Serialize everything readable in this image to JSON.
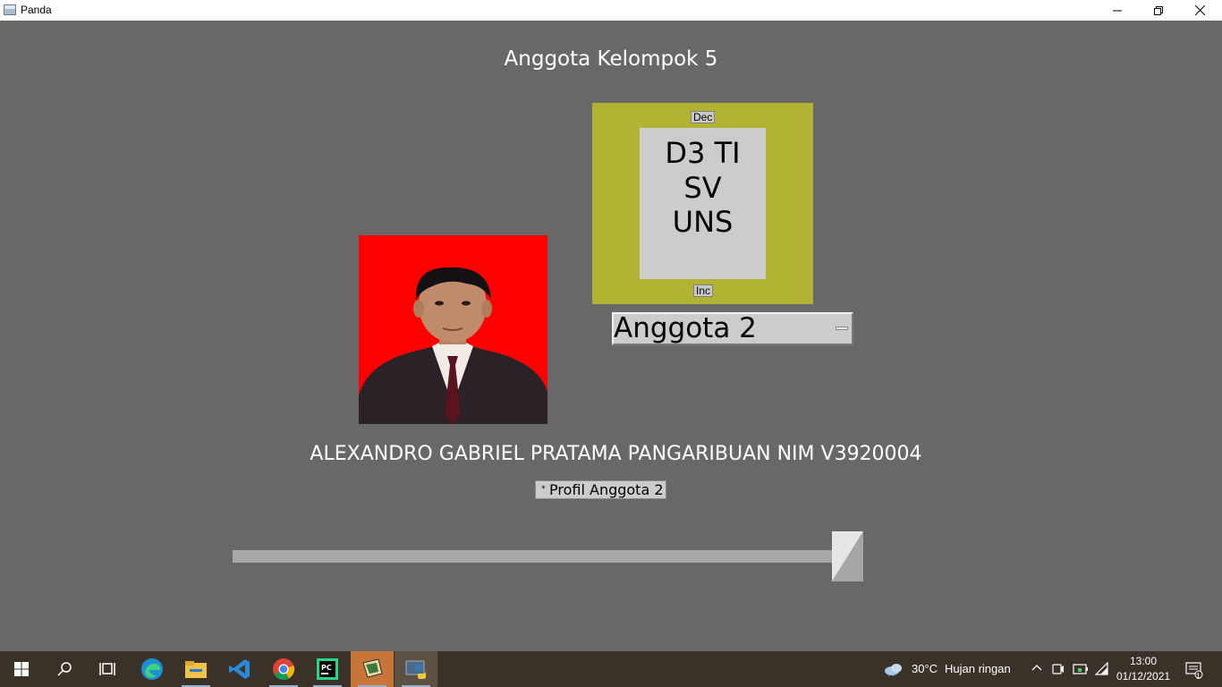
{
  "window": {
    "title": "Panda",
    "minimize_icon": "minimize-icon",
    "maximize_icon": "restore-icon",
    "close_icon": "close-icon"
  },
  "main": {
    "heading": "Anggota Kelompok 5",
    "text_frame": {
      "dec_label": "Dec",
      "inc_label": "Inc",
      "lines": [
        "D3 TI",
        "SV",
        "UNS"
      ]
    },
    "option_menu": {
      "selected": "Anggota 2"
    },
    "member_photo": "portrait photo with red background",
    "member_info": "ALEXANDRO GABRIEL PRATAMA PANGARIBUAN NIM V3920004",
    "checkbox": {
      "label": "Profil Anggota 2",
      "checked": true,
      "mark": "*"
    },
    "slider": {
      "value_fraction": 1.0
    }
  },
  "taskbar": {
    "apps": [
      "start-icon",
      "search-icon",
      "task-view-icon",
      "edge-icon",
      "file-explorer-icon",
      "vscode-icon",
      "chrome-icon",
      "pycharm-icon",
      "panda3d-icon",
      "python-icon"
    ],
    "weather": "30°C",
    "weather_text": "Hujan ringan",
    "time": "13:00",
    "date": "01/12/2021",
    "notification_count": "1"
  },
  "colors": {
    "background": "#686868",
    "frame": "#b2b333",
    "photo_bg": "#ff0000",
    "taskbar": "#3a3128"
  }
}
